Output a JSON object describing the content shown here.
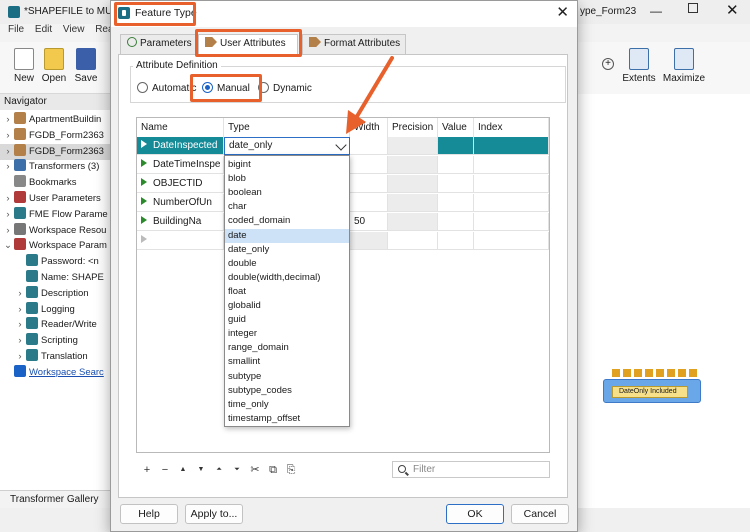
{
  "background_app": {
    "title": "*SHAPEFILE to MULT",
    "title_right": "ype_Form23",
    "menu": [
      "File",
      "Edit",
      "View",
      "Rea"
    ],
    "toolbar": {
      "new": "New",
      "open": "Open",
      "save": "Save",
      "extents": "Extents",
      "maximize": "Maximize"
    },
    "navigator": {
      "title": "Navigator",
      "items": [
        {
          "expander": "›",
          "label": "ApartmentBuildin"
        },
        {
          "expander": "›",
          "label": "FGDB_Form2363"
        },
        {
          "expander": "›",
          "label": "FGDB_Form2363"
        },
        {
          "expander": "›",
          "label": "Transformers (3)"
        },
        {
          "expander": "",
          "label": "Bookmarks"
        },
        {
          "expander": "›",
          "label": "User Parameters"
        },
        {
          "expander": "›",
          "label": "FME Flow Parame"
        },
        {
          "expander": "›",
          "label": "Workspace Resou"
        },
        {
          "expander": "⌄",
          "label": "Workspace Param"
        },
        {
          "expander": "",
          "label": "Password: <n"
        },
        {
          "expander": "",
          "label": "Name: SHAPE"
        },
        {
          "expander": "›",
          "label": "Description"
        },
        {
          "expander": "›",
          "label": "Logging"
        },
        {
          "expander": "›",
          "label": "Reader/Write"
        },
        {
          "expander": "›",
          "label": "Scripting"
        },
        {
          "expander": "›",
          "label": "Translation"
        },
        {
          "expander": "",
          "label": "Workspace Searc"
        }
      ]
    },
    "transformer_gallery": "Transformer Gallery",
    "canvas_transformer_label": "DateOnly Included"
  },
  "dialog": {
    "title": "Feature Type",
    "tabs": [
      {
        "label": "Parameters",
        "icon": "gear-icon"
      },
      {
        "label": "User Attributes",
        "icon": "attribute-arrow-icon"
      },
      {
        "label": "Format Attributes",
        "icon": "attribute-arrow-icon"
      }
    ],
    "attribute_definition": {
      "title": "Attribute Definition",
      "options": [
        "Automatic",
        "Manual",
        "Dynamic"
      ],
      "selected": "Manual"
    },
    "grid": {
      "columns": [
        "Name",
        "Type",
        "Width",
        "Precision",
        "Value",
        "Index"
      ],
      "rows": [
        {
          "name": "DateInspected",
          "type": "date_only",
          "width": ""
        },
        {
          "name": "DateTimeInspe",
          "type": "",
          "width": ""
        },
        {
          "name": "OBJECTID",
          "type": "",
          "width": ""
        },
        {
          "name": "NumberOfUn",
          "type": "",
          "width": ""
        },
        {
          "name": "BuildingNa",
          "type": "",
          "width": "50"
        }
      ]
    },
    "type_dropdown": {
      "current": "date_only",
      "hovered": "date",
      "options": [
        "bigint",
        "blob",
        "boolean",
        "char",
        "coded_domain",
        "date",
        "date_only",
        "double",
        "double(width,decimal)",
        "float",
        "globalid",
        "guid",
        "integer",
        "range_domain",
        "smallint",
        "subtype",
        "subtype_codes",
        "time_only",
        "timestamp_offset"
      ]
    },
    "filter_placeholder": "Filter",
    "buttons": {
      "help": "Help",
      "apply_to": "Apply to...",
      "ok": "OK",
      "cancel": "Cancel"
    },
    "highlight_color": "#e8612c",
    "selection_color": "#168b98"
  }
}
